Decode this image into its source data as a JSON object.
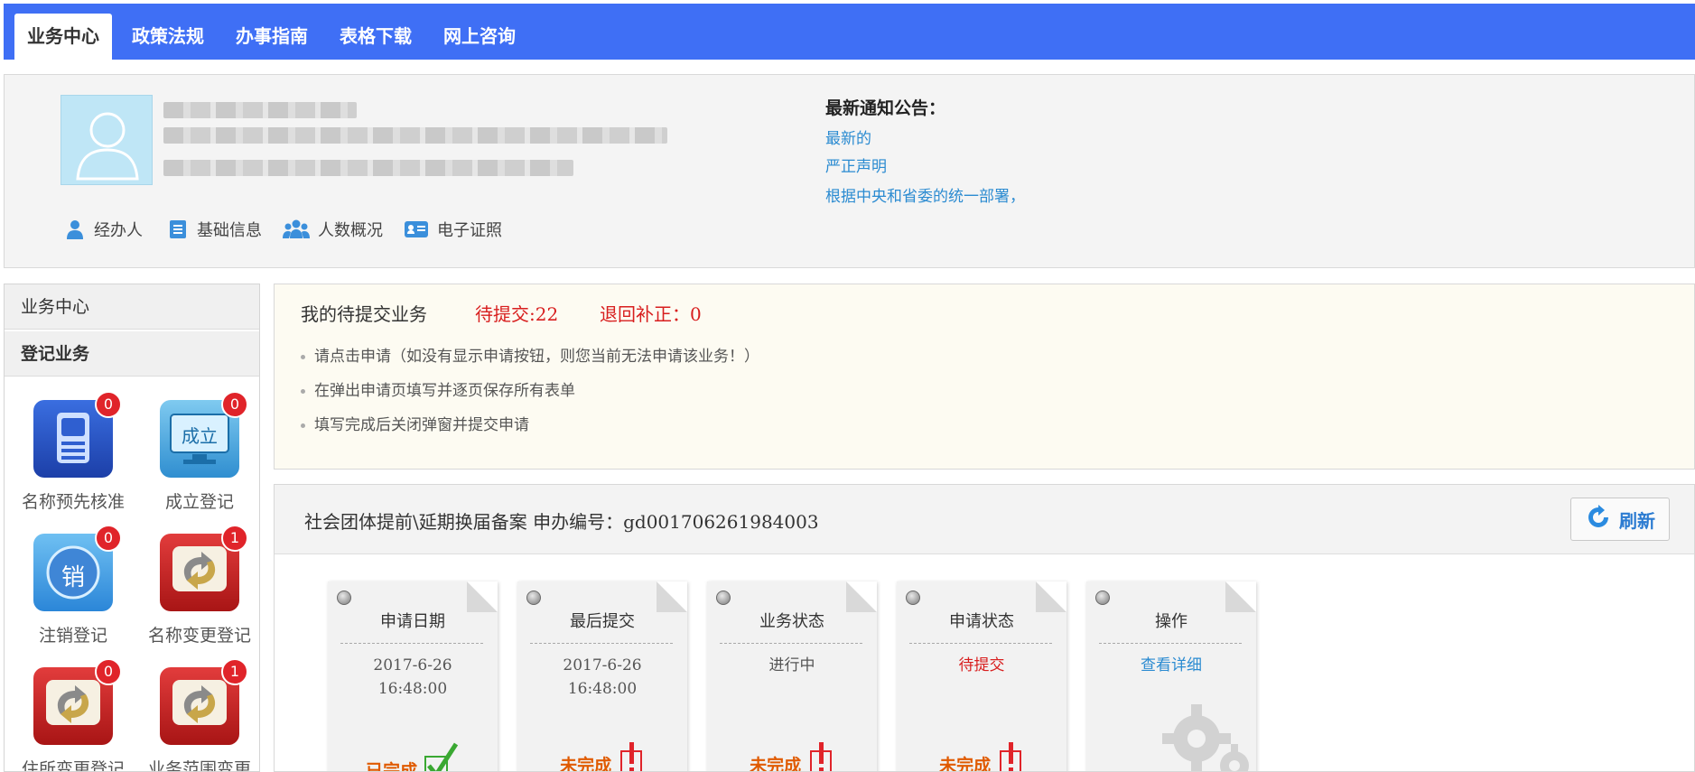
{
  "nav": {
    "tabs": [
      {
        "label": "业务中心",
        "active": true
      },
      {
        "label": "政策法规"
      },
      {
        "label": "办事指南"
      },
      {
        "label": "表格下载"
      },
      {
        "label": "网上咨询"
      }
    ]
  },
  "profile": {
    "quick_links": [
      {
        "label": "经办人",
        "icon": "person-icon"
      },
      {
        "label": "基础信息",
        "icon": "document-icon"
      },
      {
        "label": "人数概况",
        "icon": "group-icon"
      },
      {
        "label": "电子证照",
        "icon": "id-card-icon"
      }
    ]
  },
  "notices": {
    "title": "最新通知公告：",
    "items": [
      "最新的",
      "严正声明",
      "根据中央和省委的统一部署，"
    ]
  },
  "sidebar": {
    "header": "业务中心",
    "section": "登记业务",
    "items": [
      {
        "label": "名称预先核准",
        "badge": "0",
        "icon": "phone-icon"
      },
      {
        "label": "成立登记",
        "badge": "0",
        "icon": "establish-monitor-icon",
        "icon_text": "成立"
      },
      {
        "label": "注销登记",
        "badge": "0",
        "icon": "cancel-icon",
        "icon_text": "销"
      },
      {
        "label": "名称变更登记",
        "badge": "1",
        "icon": "change-arrows-icon"
      },
      {
        "label": "住所变更登记",
        "badge": "0",
        "icon": "change-arrows-icon"
      },
      {
        "label": "业务范围变更",
        "badge": "1",
        "icon": "change-arrows-icon"
      }
    ]
  },
  "pending": {
    "title": "我的待提交业务",
    "pending_label": "待提交:22",
    "returned_label": "退回补正：0",
    "tips": [
      "请点击申请（如没有显示申请按钮，则您当前无法申请该业务！）",
      "在弹出申请页填写并逐页保存所有表单",
      "填写完成后关闭弹窗并提交申请"
    ]
  },
  "record": {
    "title": "社会团体提前\\延期换届备案 申办编号：gd001706261984003",
    "refresh_label": "刷新",
    "cards": [
      {
        "header": "申请日期",
        "value_line1": "2017-6-26",
        "value_line2": "16:48:00",
        "status": "已完成"
      },
      {
        "header": "最后提交",
        "value_line1": "2017-6-26",
        "value_line2": "16:48:00",
        "status": "未完成"
      },
      {
        "header": "业务状态",
        "value_line1": "进行中",
        "status": "未完成"
      },
      {
        "header": "申请状态",
        "value_line1": "待提交",
        "status": "未完成"
      },
      {
        "header": "操作",
        "value_line1": "查看详细"
      }
    ]
  },
  "colors": {
    "nav_blue": "#3f6ff5",
    "link_blue": "#2b8bd1",
    "alert_red": "#d81e1e",
    "status_orange": "#e05a00",
    "check_green": "#3aa832"
  }
}
